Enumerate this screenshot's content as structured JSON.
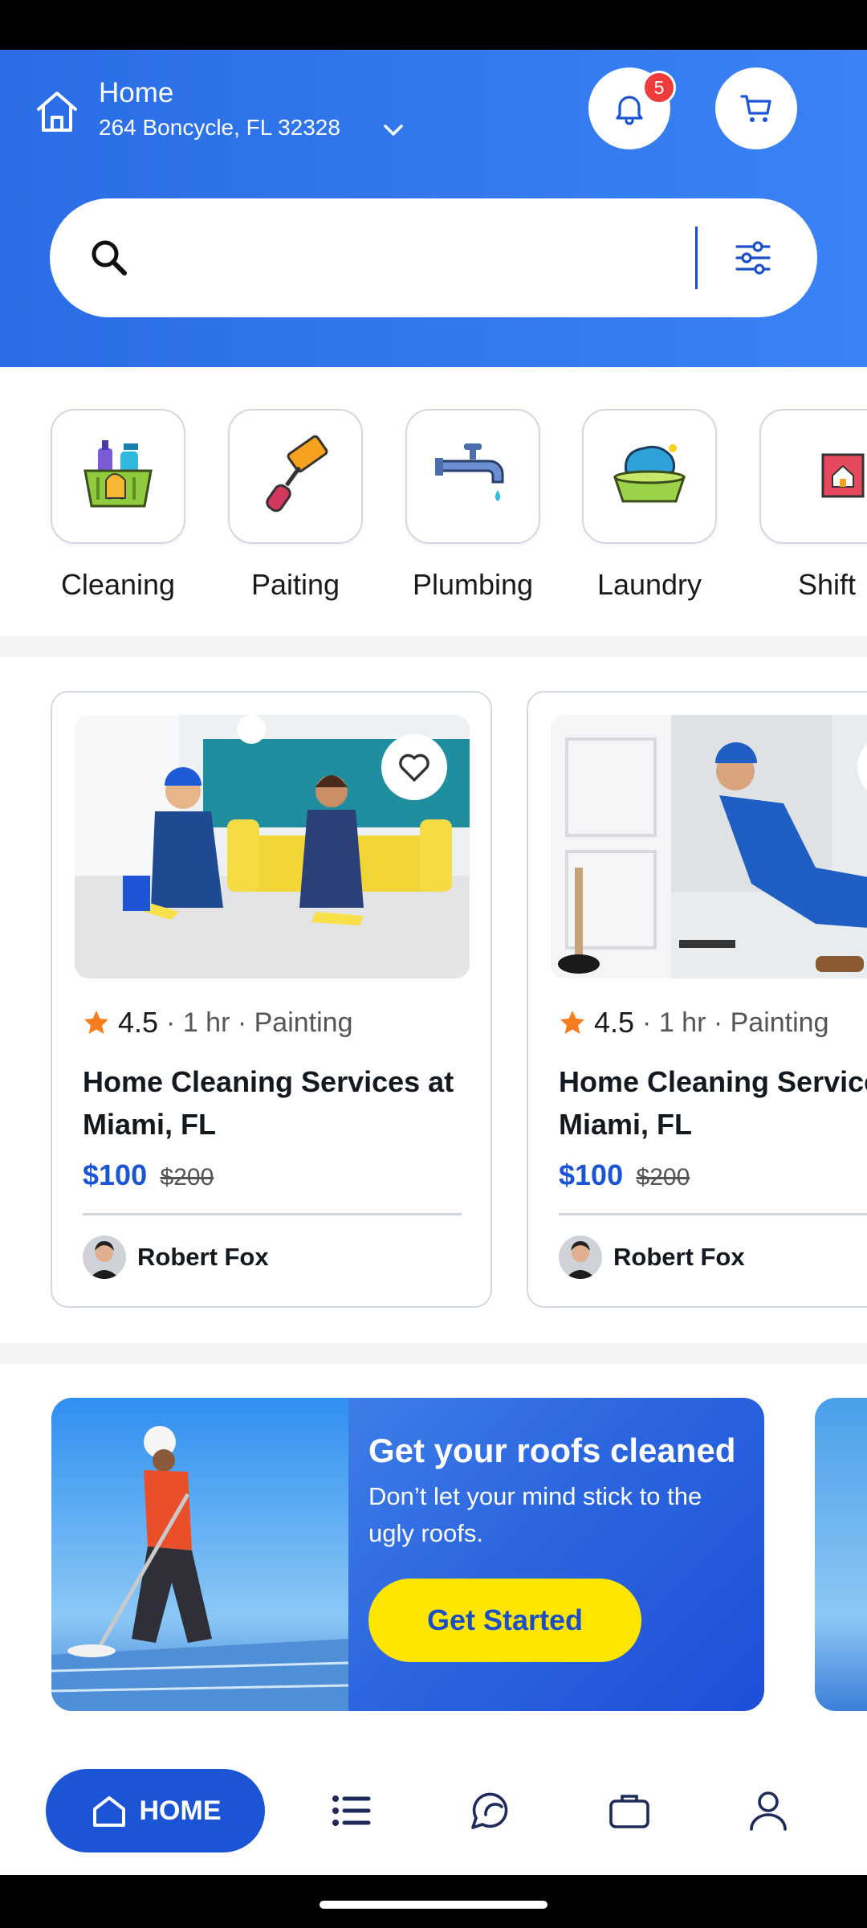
{
  "header": {
    "location_title": "Home",
    "location_address": "264 Boncycle, FL 32328",
    "notification_count": "5"
  },
  "search": {
    "placeholder": ""
  },
  "categories": [
    {
      "label": "Cleaning",
      "icon": "cleaning-basket-icon"
    },
    {
      "label": "Paiting",
      "icon": "paint-roller-icon"
    },
    {
      "label": "Plumbing",
      "icon": "faucet-icon"
    },
    {
      "label": "Laundry",
      "icon": "laundry-basket-icon"
    },
    {
      "label": "Shift",
      "icon": "moving-truck-icon"
    }
  ],
  "services": [
    {
      "rating": "4.5",
      "meta": "· 1 hr · Painting",
      "title": "Home Cleaning Services at Miami, FL",
      "price": "$100",
      "old_price": "$200",
      "provider": "Robert Fox"
    },
    {
      "rating": "4.5",
      "meta": "· 1 hr · Painting",
      "title": "Home Cleaning Services at Miami, FL",
      "price": "$100",
      "old_price": "$200",
      "provider": "Robert Fox"
    }
  ],
  "banner": {
    "title": "Get your roofs cleaned",
    "subtitle": "Don’t let your mind stick to the ugly roofs.",
    "cta": "Get Started"
  },
  "nav": {
    "home_label": "HOME",
    "items": [
      "list-icon",
      "chat-icon",
      "briefcase-icon",
      "profile-icon"
    ]
  },
  "colors": {
    "primary": "#1b55d6",
    "header_bg": "#2f75ea",
    "badge": "#ef3b3b",
    "cta": "#ffe600",
    "star": "#f57c1f"
  }
}
